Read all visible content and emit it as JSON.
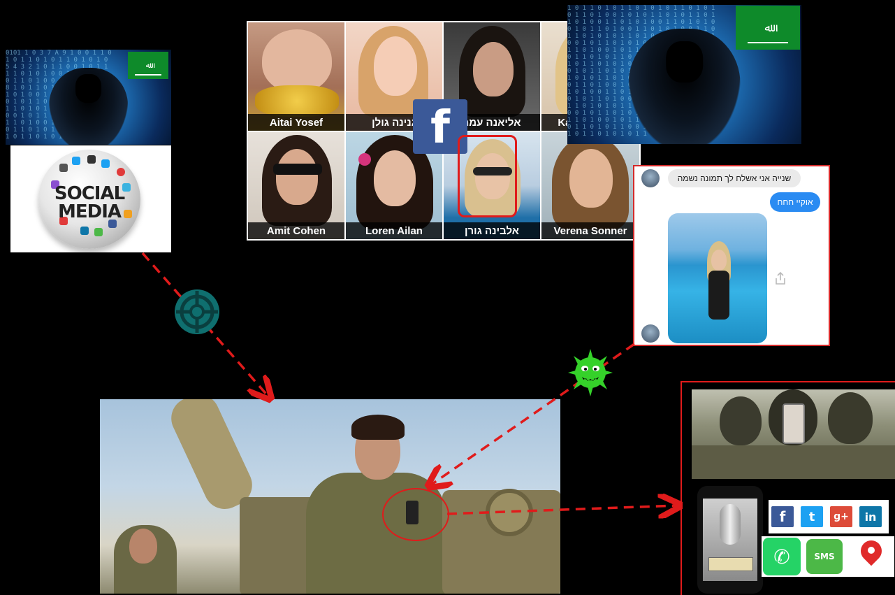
{
  "colors": {
    "arrow": "#e01b1b",
    "flag_green": "#0e8a2a",
    "facebook": "#3b5998",
    "twitter": "#1da1f2",
    "gplus": "#dd4b39",
    "linkedin": "#0e76a8",
    "whatsapp": "#25d366",
    "sms": "#4cb847",
    "spy_teal": "#0f6f6f",
    "virus_green": "#35d12a"
  },
  "social_media_globe": {
    "line1": "SOCIAL",
    "line2": "MEDIA"
  },
  "profiles": [
    {
      "name": "Aitai Yosef"
    },
    {
      "name": "גנינה גולן"
    },
    {
      "name": "אליאנה עמר"
    },
    {
      "name": "Karen Cohen"
    },
    {
      "name": "Amit Cohen"
    },
    {
      "name": "Loren Ailan"
    },
    {
      "name": "אלבינה גורן"
    },
    {
      "name": "Verena Sonner"
    }
  ],
  "facebook_logo": "f",
  "chat": {
    "incoming_message": "שנייה אני אשלח לך תמונה נשמה",
    "outgoing_message": "אוקיי חחח"
  },
  "icons": [
    "hacker-image",
    "flag-icon",
    "spy-icon",
    "virus-icon",
    "share-icon",
    "microphone-icon",
    "location-pin-icon"
  ],
  "share_targets": [
    {
      "name": "facebook",
      "glyph": "f"
    },
    {
      "name": "twitter",
      "glyph": "t"
    },
    {
      "name": "google-plus",
      "glyph": "g+"
    },
    {
      "name": "linkedin",
      "glyph": "in"
    }
  ],
  "apps": [
    {
      "name": "whatsapp",
      "glyph": "✆"
    },
    {
      "name": "sms",
      "glyph": "SMS"
    }
  ]
}
